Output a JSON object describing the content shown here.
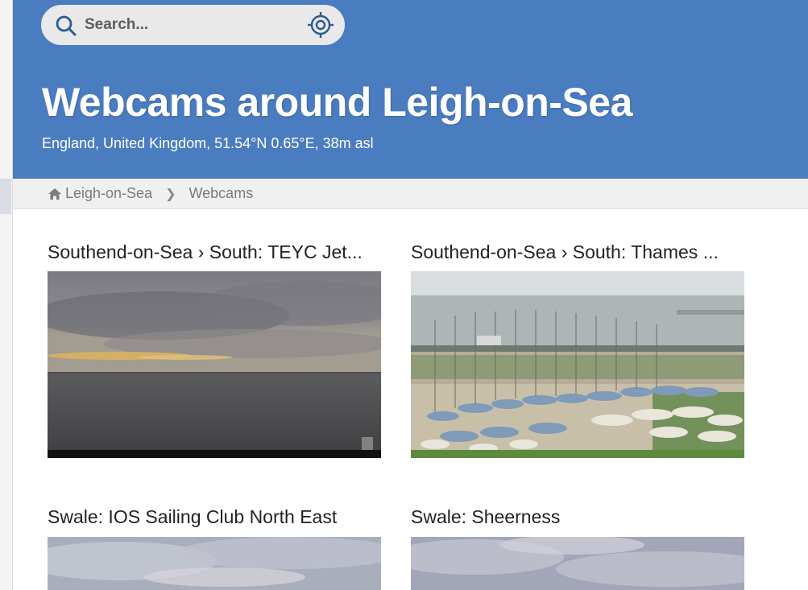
{
  "search": {
    "placeholder": "Search..."
  },
  "header": {
    "title": "Webcams around Leigh-on-Sea",
    "subtitle": "England, United Kingdom, 51.54°N 0.65°E, 38m asl"
  },
  "breadcrumb": {
    "home_label": "Leigh-on-Sea",
    "current_label": "Webcams",
    "separator": "❯"
  },
  "webcams": [
    {
      "title": "Southend-on-Sea › South: TEYC Jet..."
    },
    {
      "title": "Southend-on-Sea › South: Thames ..."
    },
    {
      "title": "Swale: IOS Sailing Club North East"
    },
    {
      "title": "Swale: Sheerness"
    }
  ],
  "colors": {
    "header_bg": "#4a7cc0",
    "breadcrumb_bg": "#f0f0f1",
    "search_bg": "#e9e9e9"
  },
  "icons": {
    "search": "search-icon",
    "locate": "crosshair-location-icon",
    "home": "home-icon"
  }
}
